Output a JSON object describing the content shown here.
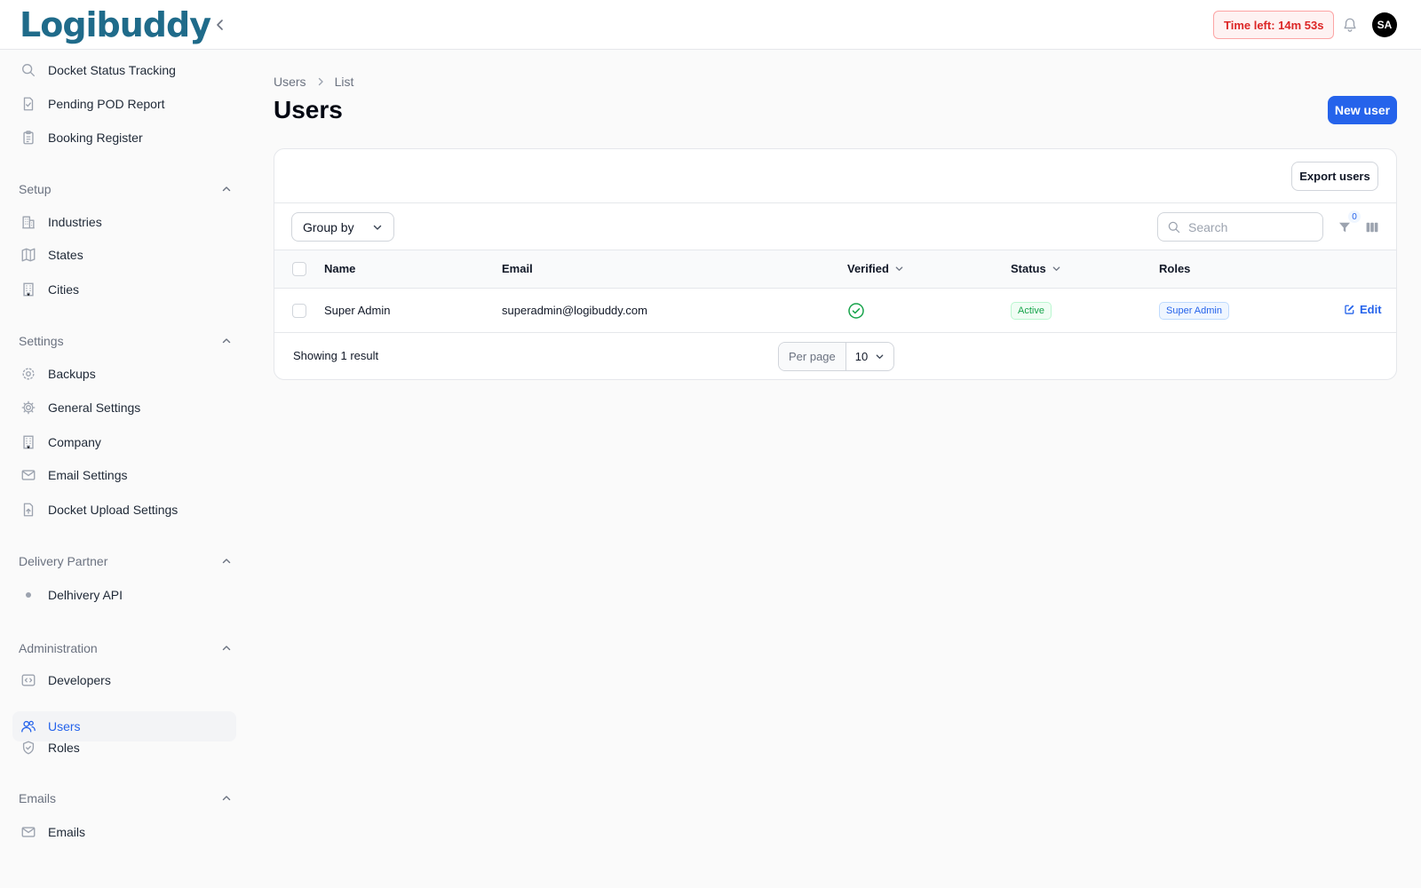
{
  "app": {
    "logo_text": "Logibuddy",
    "timer": "Time left: 14m 53s",
    "avatar_initials": "SA"
  },
  "sidebar": {
    "top_items": [
      {
        "label": "Docket Status Tracking",
        "icon": "search-icon"
      },
      {
        "label": "Pending POD Report",
        "icon": "document-check-icon"
      },
      {
        "label": "Booking Register",
        "icon": "clipboard-icon"
      }
    ],
    "groups": [
      {
        "label": "Setup",
        "items": [
          {
            "label": "Industries",
            "icon": "building-icon"
          },
          {
            "label": "States",
            "icon": "map-icon"
          },
          {
            "label": "Cities",
            "icon": "office-building-icon"
          }
        ]
      },
      {
        "label": "Settings",
        "items": [
          {
            "label": "Backups",
            "icon": "cog-backup-icon"
          },
          {
            "label": "General Settings",
            "icon": "gear-icon"
          },
          {
            "label": "Company",
            "icon": "office-building-icon"
          },
          {
            "label": "Email Settings",
            "icon": "envelope-icon"
          },
          {
            "label": "Docket Upload Settings",
            "icon": "document-upload-icon"
          }
        ]
      },
      {
        "label": "Delivery Partner",
        "items": [
          {
            "label": "Delhivery API",
            "icon": "bullet-icon"
          }
        ]
      },
      {
        "label": "Administration",
        "items": [
          {
            "label": "Developers",
            "icon": "code-icon"
          },
          {
            "label": "Users",
            "icon": "users-icon",
            "active": true
          },
          {
            "label": "Roles",
            "icon": "shield-check-icon"
          }
        ]
      },
      {
        "label": "Emails",
        "items": [
          {
            "label": "Emails",
            "icon": "envelope-icon"
          }
        ]
      }
    ]
  },
  "breadcrumb": [
    "Users",
    "List"
  ],
  "page": {
    "title": "Users",
    "new_button": "New user",
    "export_button": "Export users"
  },
  "toolbar": {
    "group_by": "Group by",
    "search_placeholder": "Search",
    "filter_count": "0"
  },
  "table": {
    "columns": [
      "Name",
      "Email",
      "Verified",
      "Status",
      "Roles"
    ],
    "rows": [
      {
        "name": "Super Admin",
        "email": "superadmin@logibuddy.com",
        "verified": true,
        "status": "Active",
        "role": "Super Admin",
        "action": "Edit"
      }
    ]
  },
  "footer": {
    "showing": "Showing 1 result",
    "per_page_label": "Per page",
    "per_page_value": "10"
  },
  "colors": {
    "primary": "#2563eb",
    "logo": "#1f6b8a",
    "logo_dot": "#e0245e",
    "timer_text": "#dc2626",
    "success": "#16a34a"
  }
}
